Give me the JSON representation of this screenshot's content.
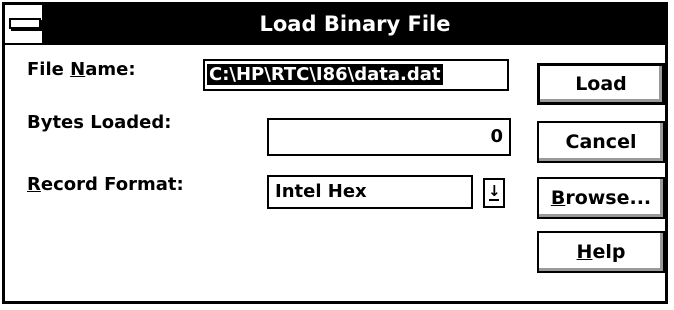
{
  "window": {
    "title": "Load Binary File"
  },
  "labels": {
    "file_name_pre": "File ",
    "file_name_u": "N",
    "file_name_post": "ame:",
    "bytes_loaded": "Bytes Loaded:",
    "record_format_u": "R",
    "record_format_post": "ecord Format:"
  },
  "fields": {
    "file_name_value": "C:\\HP\\RTC\\I86\\data.dat",
    "bytes_loaded_value": "0",
    "record_format_value": "Intel Hex"
  },
  "buttons": {
    "load": "Load",
    "cancel": "Cancel",
    "browse_u": "B",
    "browse_post": "rowse...",
    "help_u": "H",
    "help_post": "elp"
  },
  "icons": {
    "system_menu": "system-menu-icon",
    "dropdown_arrow": "down-arrow-icon"
  }
}
